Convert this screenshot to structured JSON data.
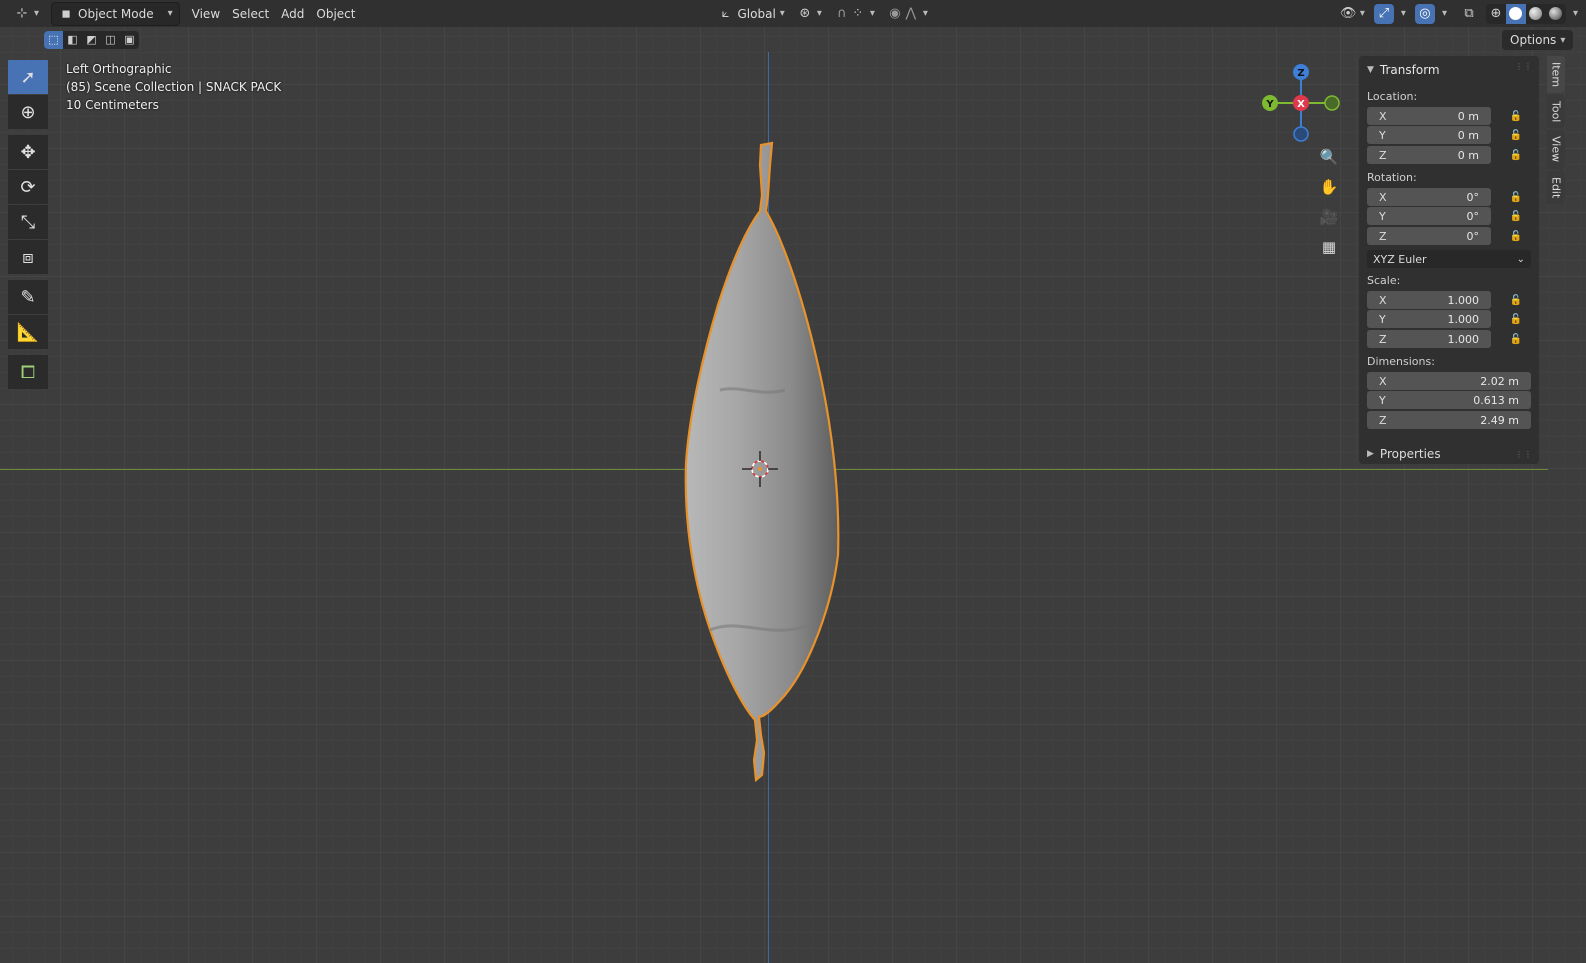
{
  "header": {
    "editor_type_icon": "viewport-editor-icon",
    "mode": "Object Mode",
    "menu": [
      "View",
      "Select",
      "Add",
      "Object"
    ],
    "orientation": "Global"
  },
  "options_label": "Options",
  "overlay": {
    "view_name": "Left Orthographic",
    "collection": "(85) Scene Collection | SNACK PACK",
    "grid_scale": "10 Centimeters"
  },
  "gizmo": {
    "z": "Z",
    "y": "Y",
    "x": "X"
  },
  "transform": {
    "title": "Transform",
    "location_label": "Location:",
    "location": [
      {
        "axis": "X",
        "value": "0 m"
      },
      {
        "axis": "Y",
        "value": "0 m"
      },
      {
        "axis": "Z",
        "value": "0 m"
      }
    ],
    "rotation_label": "Rotation:",
    "rotation": [
      {
        "axis": "X",
        "value": "0°"
      },
      {
        "axis": "Y",
        "value": "0°"
      },
      {
        "axis": "Z",
        "value": "0°"
      }
    ],
    "rotation_mode": "XYZ Euler",
    "scale_label": "Scale:",
    "scale": [
      {
        "axis": "X",
        "value": "1.000"
      },
      {
        "axis": "Y",
        "value": "1.000"
      },
      {
        "axis": "Z",
        "value": "1.000"
      }
    ],
    "dimensions_label": "Dimensions:",
    "dimensions": [
      {
        "axis": "X",
        "value": "2.02 m"
      },
      {
        "axis": "Y",
        "value": "0.613 m"
      },
      {
        "axis": "Z",
        "value": "2.49 m"
      }
    ]
  },
  "properties_label": "Properties",
  "tabs": [
    "Item",
    "Tool",
    "View",
    "Edit"
  ],
  "colors": {
    "accent": "#4772b3",
    "selection_outline": "#e8922c",
    "axis_x": "#e0394c",
    "axis_y": "#7dba30",
    "axis_z": "#3d7fd9"
  }
}
